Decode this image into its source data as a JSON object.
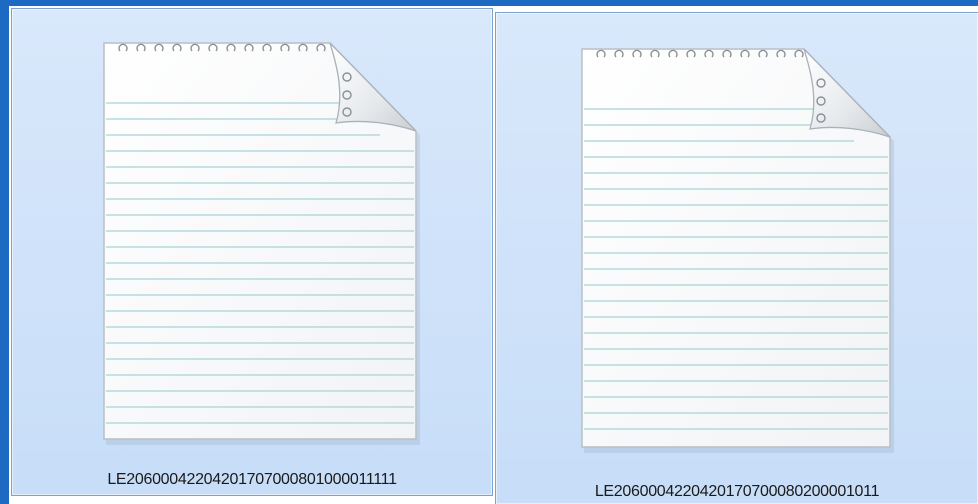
{
  "explorer": {
    "accent_color": "#1c6ac2",
    "selection_color": "#cfe2fa",
    "files": [
      {
        "name": "LE20600042204201707000801000011111",
        "icon": "text-document-icon",
        "selected": true
      },
      {
        "name": "LE2060004220420170700080200001011",
        "icon": "text-document-icon",
        "selected": true
      }
    ]
  }
}
